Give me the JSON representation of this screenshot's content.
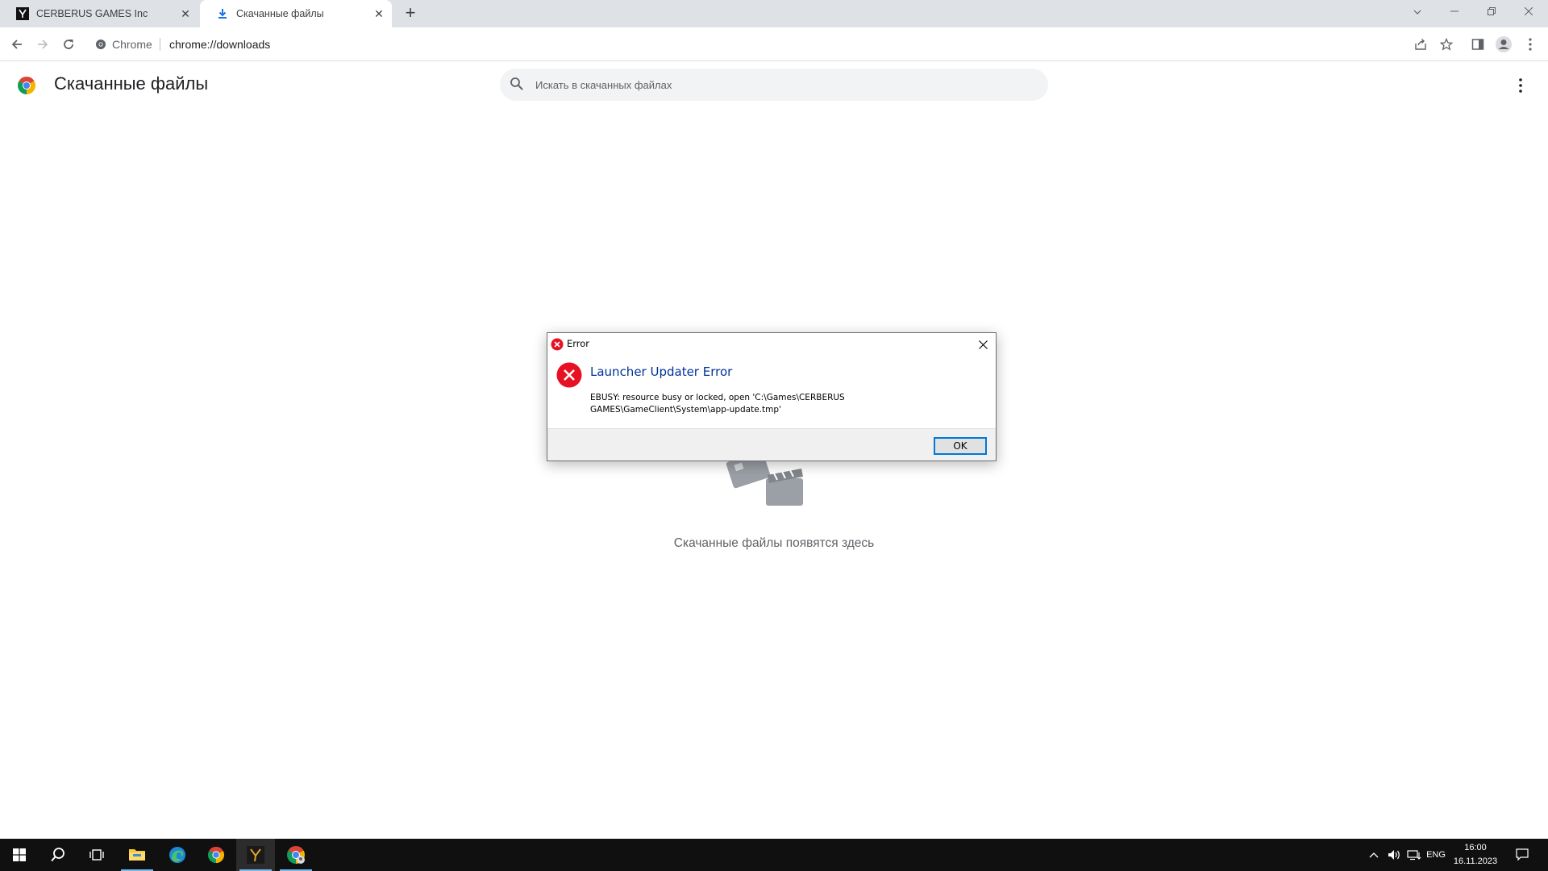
{
  "tabs": [
    {
      "title": "CERBERUS GAMES Inc",
      "icon": "cerberus-logo-icon",
      "active": false
    },
    {
      "title": "Скачанные файлы",
      "icon": "download-icon",
      "active": true
    }
  ],
  "toolbar": {
    "site_label": "Chrome",
    "url": "chrome://downloads"
  },
  "downloads": {
    "title": "Скачанные файлы",
    "search_placeholder": "Искать в скачанных файлах",
    "empty_text": "Скачанные файлы появятся здесь"
  },
  "dialog": {
    "title": "Error",
    "heading": "Launcher Updater Error",
    "message_line1": "EBUSY: resource busy or locked, open 'C:\\Games\\CERBERUS",
    "message_line2": "GAMES\\GameClient\\System\\app-update.tmp'",
    "ok_label": "OK"
  },
  "taskbar": {
    "apps": [
      "windows-start-icon",
      "search-icon",
      "task-view-icon",
      "file-explorer-icon",
      "edge-icon",
      "chrome-icon",
      "cerberus-launcher-icon",
      "chrome-profile-icon"
    ],
    "language": "ENG",
    "time": "16:00",
    "date": "16.11.2023"
  },
  "colors": {
    "accent": "#1a73e8",
    "error_red": "#e81123",
    "dialog_heading": "#003399",
    "taskbar_bg": "#101010"
  }
}
